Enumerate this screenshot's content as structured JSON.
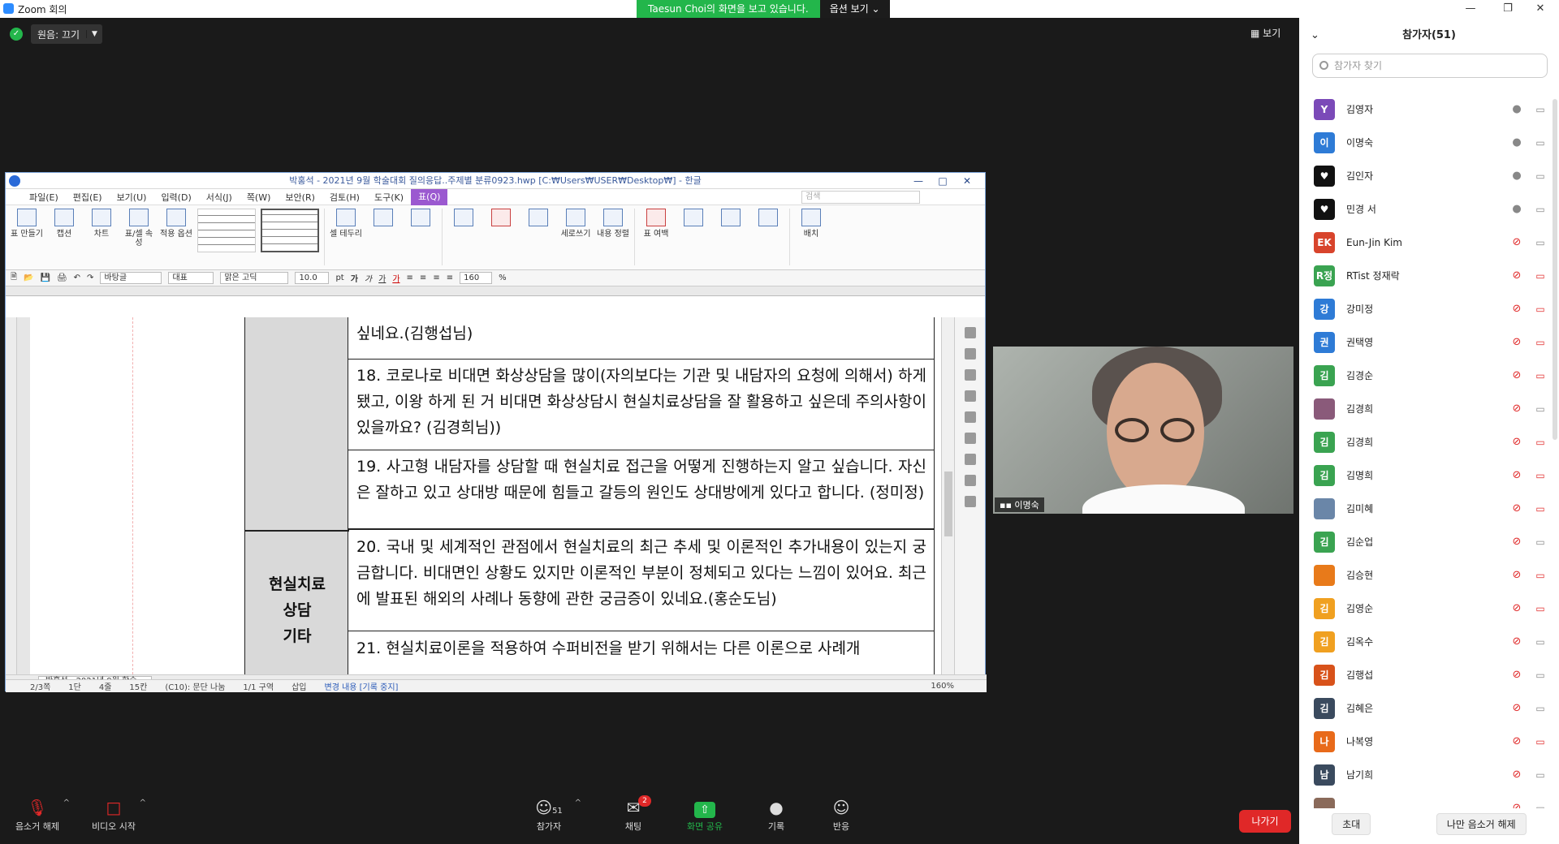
{
  "zoom": {
    "window_title": "Zoom 회의",
    "share_banner": "Taesun Choi의 화면을 보고 있습니다.",
    "view_options": "옵션 보기 ⌄",
    "original_sound": "원음: 끄기",
    "view_label": "보기"
  },
  "hwp": {
    "title": "박홍석 - 2021년 9월 학술대회 질의응답..주제별 분류0923.hwp [C:₩Users₩USER₩Desktop₩] - 한글",
    "menu": [
      "파일(E)",
      "편집(E)",
      "보기(U)",
      "입력(D)",
      "서식(J)",
      "쪽(W)",
      "보안(R)",
      "검토(H)",
      "도구(K)",
      "표(Q)"
    ],
    "search_placeholder": "검색",
    "ribbon": [
      "표 만들기",
      "캡션",
      "차트",
      "표/셀 속성",
      "적용 옵션",
      "셀 테두리",
      "세로쓰기",
      "내용 정렬",
      "표 여백",
      "배치"
    ],
    "fmt": {
      "style": "바탕글",
      "lang": "대표",
      "font": "맑은 고딕",
      "size": "10.0",
      "unit": "pt",
      "zoom": "160",
      "pct": "%"
    },
    "rows": [
      "싶네요.(김행섭님)",
      "18. 코로나로 비대면 화상상담을 많이(자의보다는 기관 및 내담자의 요청에 의해서) 하게 됐고, 이왕 하게 된 거 비대면 화상상담시 현실치료상담을 잘 활용하고 싶은데 주의사항이 있을까요? (김경희님))",
      "19. 사고형 내담자를 상담할 때 현실치료 접근을 어떻게 진행하는지 알고 싶습니다. 자신은 잘하고 있고 상대방 때문에 힘들고 갈등의 원인도 상대방에게 있다고 합니다. (정미정)",
      "20. 국내 및 세계적인 관점에서 현실치료의 최근 추세 및 이론적인 추가내용이 있는지 궁금합니다. 비대면인 상황도 있지만 이론적인 부분이 정체되고 있다는 느낌이 있어요. 최근에 발표된 해외의 사례나 동향에 관한 궁금증이 있네요.(홍순도님)",
      "21. 현실치료이론을 적용하여 수퍼비전을 받기 위해서는 다른 이론으로 사례개"
    ],
    "category": [
      "현실치료",
      "상담",
      "기타"
    ],
    "tab": "박홍석 - 2021년 9월 학술...",
    "status": [
      "2/3쪽",
      "1단",
      "4줄",
      "15칸",
      "(C10): 문단 나눔",
      "1/1 구역",
      "삽입",
      "변경 내용 [기록 중지]"
    ],
    "status_zoom": "160%"
  },
  "video": {
    "name": "이명숙"
  },
  "participants": {
    "title": "참가자(51)",
    "search_placeholder": "참가자 찾기",
    "list": [
      {
        "av": "Y",
        "color": "#7b4ab8",
        "name": "김영자",
        "mic": "on",
        "cam": "off-grey"
      },
      {
        "av": "이",
        "color": "#2e7bd6",
        "name": "이명숙",
        "mic": "on",
        "cam": "off-grey"
      },
      {
        "av": "♥",
        "color": "#111111",
        "name": "김인자",
        "mic": "on",
        "cam": "off-grey"
      },
      {
        "av": "♥",
        "color": "#111111",
        "name": "민경 서",
        "mic": "on",
        "cam": "off-grey"
      },
      {
        "av": "EK",
        "color": "#d8442c",
        "name": "Eun-Jin Kim",
        "mic": "muted",
        "cam": "off-grey"
      },
      {
        "av": "R정",
        "color": "#3aa351",
        "name": "RTist 정재락",
        "mic": "muted",
        "cam": "off"
      },
      {
        "av": "강",
        "color": "#2e7bd6",
        "name": "강미정",
        "mic": "muted",
        "cam": "off"
      },
      {
        "av": "권",
        "color": "#2e7bd6",
        "name": "권택영",
        "mic": "muted",
        "cam": "off"
      },
      {
        "av": "김",
        "color": "#3aa351",
        "name": "김경순",
        "mic": "muted",
        "cam": "off"
      },
      {
        "av": "",
        "color": "#8a5a7a",
        "name": "김경희",
        "mic": "muted",
        "cam": "off-grey"
      },
      {
        "av": "김",
        "color": "#3aa351",
        "name": "김경희",
        "mic": "muted",
        "cam": "off"
      },
      {
        "av": "김",
        "color": "#3aa351",
        "name": "김명희",
        "mic": "muted",
        "cam": "off"
      },
      {
        "av": "",
        "color": "#6a86a8",
        "name": "김미혜",
        "mic": "muted",
        "cam": "off"
      },
      {
        "av": "김",
        "color": "#3aa351",
        "name": "김순업",
        "mic": "muted",
        "cam": "off-grey"
      },
      {
        "av": "",
        "color": "#e87a1a",
        "name": "김승현",
        "mic": "muted",
        "cam": "off"
      },
      {
        "av": "김",
        "color": "#f0a020",
        "name": "김영순",
        "mic": "muted",
        "cam": "off"
      },
      {
        "av": "김",
        "color": "#f0a020",
        "name": "김옥수",
        "mic": "muted",
        "cam": "off-grey"
      },
      {
        "av": "김",
        "color": "#d8521a",
        "name": "김행섭",
        "mic": "muted",
        "cam": "off-grey"
      },
      {
        "av": "김",
        "color": "#3a4a5e",
        "name": "김혜은",
        "mic": "muted",
        "cam": "off-grey"
      },
      {
        "av": "나",
        "color": "#e86a1a",
        "name": "나복영",
        "mic": "muted",
        "cam": "off"
      },
      {
        "av": "남",
        "color": "#3a4a5e",
        "name": "남기희",
        "mic": "muted",
        "cam": "off-grey"
      },
      {
        "av": "",
        "color": "#8a6a5a",
        "name": "",
        "mic": "muted",
        "cam": "off-grey"
      }
    ],
    "invite": "초대",
    "unmute_me": "나만 음소거 해제"
  },
  "toolbar": {
    "mute": "음소거 해제",
    "video": "비디오 시작",
    "participants": "참가자",
    "participants_count": "51",
    "chat": "채팅",
    "chat_badge": "2",
    "share": "화면 공유",
    "record": "기록",
    "reactions": "반응",
    "leave": "나가기"
  }
}
